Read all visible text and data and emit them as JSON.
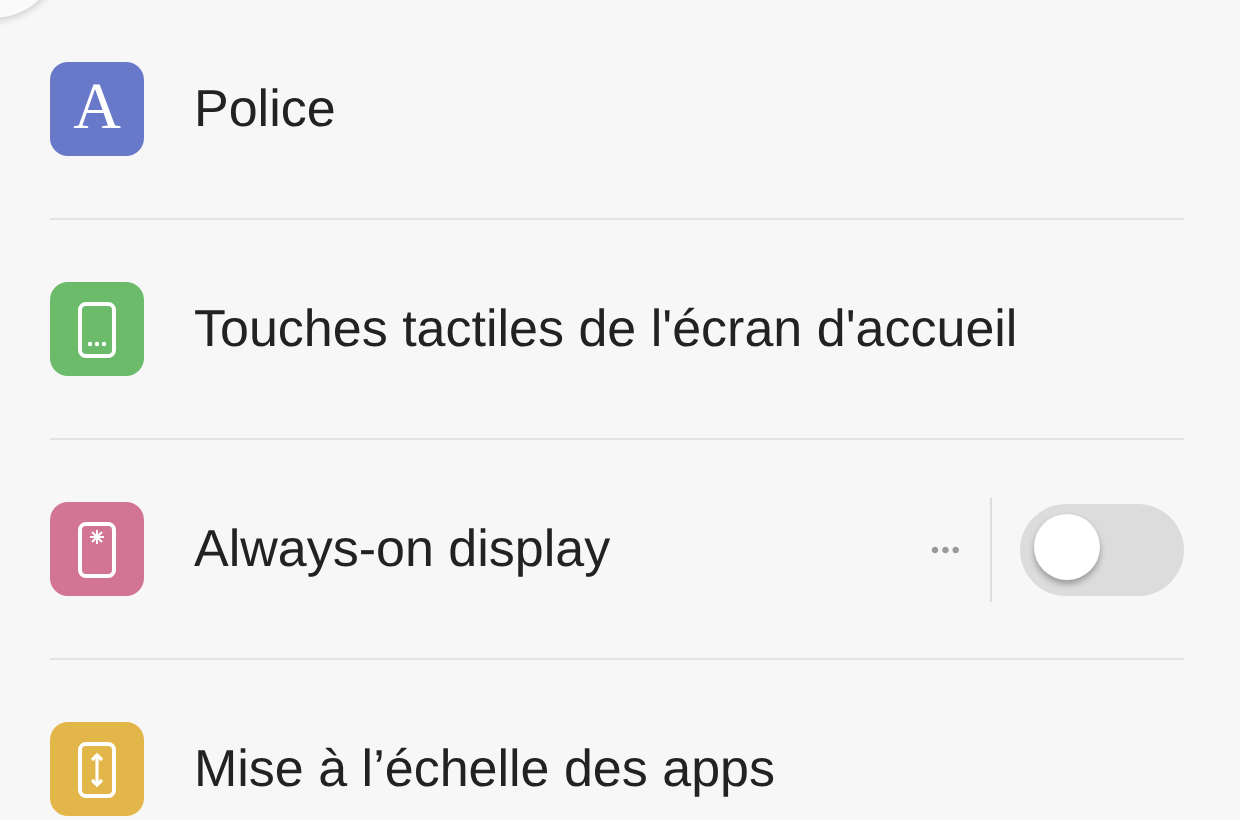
{
  "rows": [
    {
      "kind": "letter",
      "glyph": "A",
      "label": "Police",
      "color": "#6879c9"
    },
    {
      "kind": "keys",
      "label": "Touches tactiles de l'écran d'accueil",
      "color": "#6bbb6b"
    },
    {
      "kind": "glow",
      "label": "Always-on display",
      "color": "#d27493",
      "more": "•••",
      "toggle": {
        "on": false
      }
    },
    {
      "kind": "scale",
      "label": "Mise à l’échelle des apps",
      "color": "#e2b648"
    }
  ]
}
